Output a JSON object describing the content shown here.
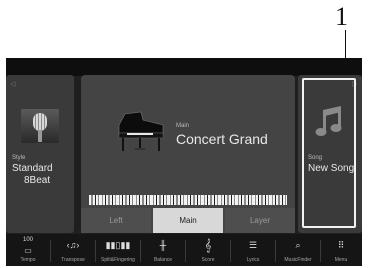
{
  "callout": {
    "number": "1"
  },
  "style_panel": {
    "label": "Style",
    "name_line1": "Standard",
    "name_line2": "8Beat"
  },
  "main_panel": {
    "label": "Main",
    "voice": "Concert Grand",
    "parts": [
      "Left",
      "Main",
      "Layer"
    ],
    "active_part": "Main"
  },
  "song_panel": {
    "label": "Song",
    "name": "New Song",
    "icon": "music-note-icon"
  },
  "bottom_bar": {
    "tempo_value": "100",
    "items": [
      {
        "label": "Tempo",
        "icon": "tempo-icon"
      },
      {
        "label": "Transpose",
        "icon": "transpose-icon"
      },
      {
        "label": "Split&Fingering",
        "icon": "split-fingering-icon"
      },
      {
        "label": "Balance",
        "icon": "balance-icon"
      },
      {
        "label": "Score",
        "icon": "treble-clef-icon"
      },
      {
        "label": "Lyrics",
        "icon": "lyrics-icon"
      },
      {
        "label": "MusicFinder",
        "icon": "music-finder-icon"
      },
      {
        "label": "Menu",
        "icon": "menu-grid-icon"
      }
    ]
  }
}
